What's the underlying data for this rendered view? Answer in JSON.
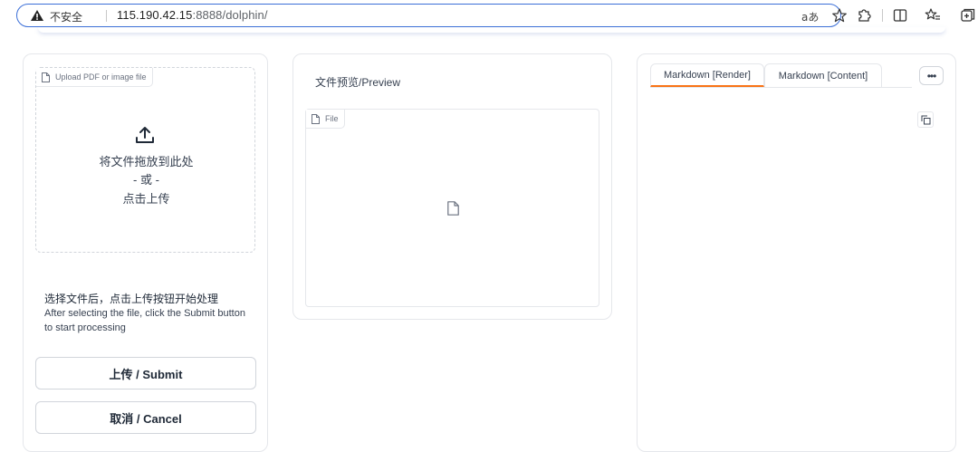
{
  "browser": {
    "security_label": "不安全",
    "url_main": "115.190.42.15",
    "url_rest": ":8888/dolphin/",
    "read_aloud": "aあ"
  },
  "left": {
    "upload_label": "Upload PDF or image file",
    "drop_line1": "将文件拖放到此处",
    "drop_line2": "- 或 -",
    "drop_line3": "点击上传",
    "instr_zh": "选择文件后，点击上传按钮开始处理",
    "instr_en": "After selecting the file, click the Submit button to start processing",
    "submit_label": "上传 / Submit",
    "cancel_label": "取消 / Cancel"
  },
  "mid": {
    "title": "文件预览/Preview",
    "file_label": "File"
  },
  "right": {
    "tabs": [
      {
        "label": "Markdown [Render]"
      },
      {
        "label": "Markdown [Content]"
      }
    ],
    "more_label": "•••"
  },
  "colors": {
    "accent": "#f97316",
    "address_border": "#3b6fd8"
  }
}
